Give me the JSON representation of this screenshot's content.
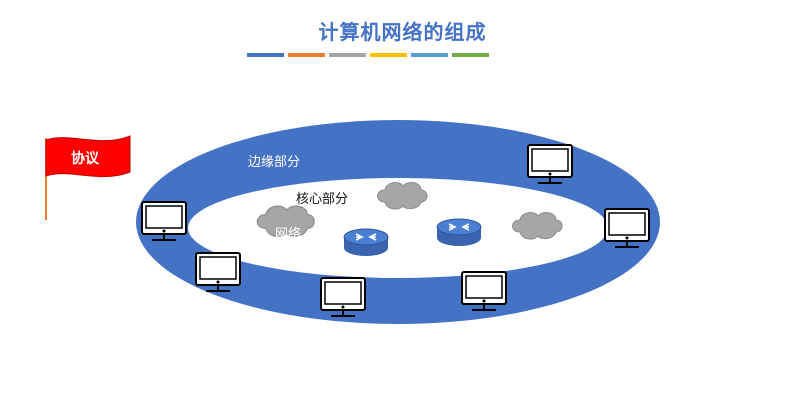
{
  "title": "计算机网络的组成",
  "color_bars": [
    "#4472c4",
    "#ed7d31",
    "#a5a5a5",
    "#ffc000",
    "#5b9bd5",
    "#70ad47"
  ],
  "labels": {
    "edge": "边缘部分",
    "core": "核心部分",
    "network": "网络",
    "protocol": "协议"
  },
  "colors": {
    "ring": "#4472c4",
    "cloud": "#a6a6a6",
    "router": "#4472c4",
    "flag": "#ff0000"
  },
  "icons": [
    "computer-icon",
    "router-icon",
    "cloud-icon",
    "flag-icon"
  ]
}
